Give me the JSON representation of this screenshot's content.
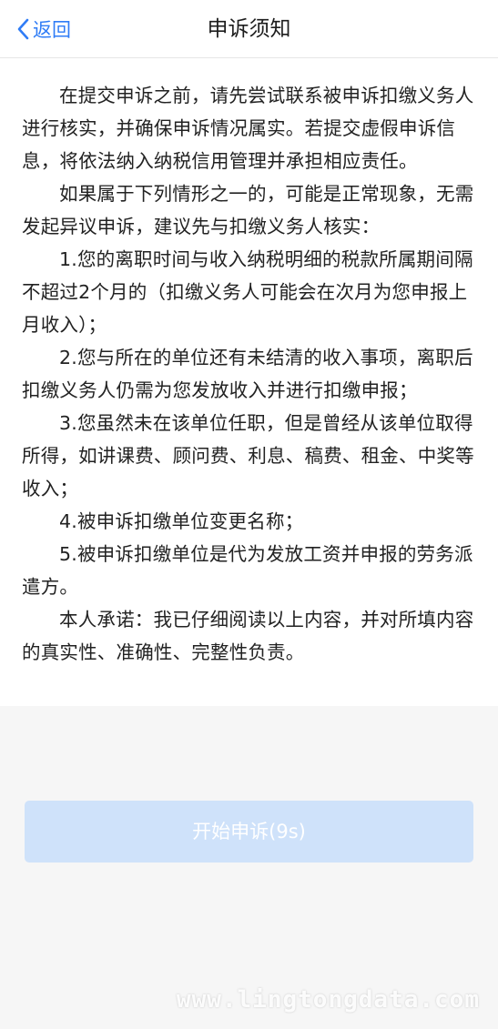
{
  "header": {
    "back_label": "返回",
    "title": "申诉须知",
    "back_icon": "chevron-left-icon",
    "accent_color": "#2f7cf6"
  },
  "notice": {
    "paragraphs": [
      "在提交申诉之前，请先尝试联系被申诉扣缴义务人进行核实，并确保申诉情况属实。若提交虚假申诉信息，将依法纳入纳税信用管理并承担相应责任。",
      "如果属于下列情形之一的，可能是正常现象，无需发起异议申诉，建议先与扣缴义务人核实：",
      "1.您的离职时间与收入纳税明细的税款所属期间隔不超过2个月的（扣缴义务人可能会在次月为您申报上月收入）；",
      "2.您与所在的单位还有未结清的收入事项，离职后扣缴义务人仍需为您发放收入并进行扣缴申报；",
      "3.您虽然未在该单位任职，但是曾经从该单位取得所得，如讲课费、顾问费、利息、稿费、租金、中奖等收入；",
      "4.被申诉扣缴单位变更名称；",
      "5.被申诉扣缴单位是代为发放工资并申报的劳务派遣方。",
      "本人承诺：我已仔细阅读以上内容，并对所填内容的真实性、准确性、完整性负责。"
    ]
  },
  "action": {
    "start_label": "开始申诉(9s)",
    "disabled": true,
    "button_color": "#cfe2fa"
  },
  "watermark": {
    "text": "www.lingtongdata.com"
  }
}
